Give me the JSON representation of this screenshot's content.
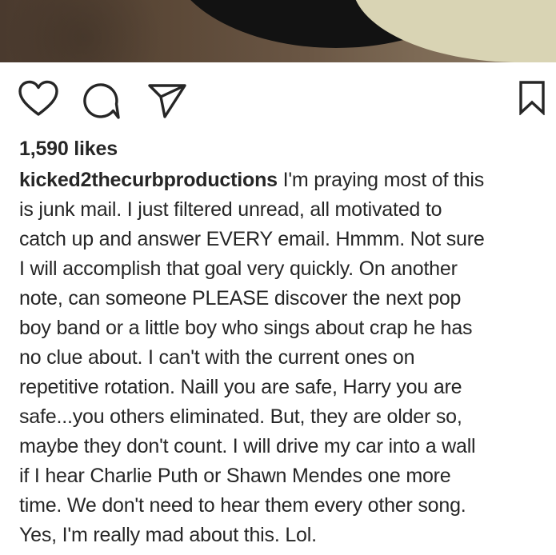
{
  "post": {
    "likes_text": "1,590 likes",
    "username": "kicked2thecurbproductions",
    "caption_lines": [
      " I'm praying most of this",
      "is junk mail. I just filtered unread, all motivated to",
      "catch up and answer EVERY email. Hmmm. Not sure",
      "I will accomplish that goal very quickly. On another",
      "note, can someone PLEASE discover the next pop",
      "boy band or a little boy who sings about crap he has",
      "no clue about. I can't with the current ones on",
      "repetitive rotation. Naill you are safe, Harry you are",
      "safe...you others eliminated. But, they are older so,",
      "maybe they don't count. I will drive my car into a wall",
      "if I hear Charlie Puth or Shawn Mendes one more",
      "time. We don't need to hear them every other song.",
      "Yes, I'm really mad about this. Lol."
    ]
  },
  "actions": {
    "icons": [
      "heart-icon",
      "comment-icon",
      "share-icon",
      "bookmark-icon"
    ]
  },
  "colors": {
    "text": "#262626",
    "icon_stroke": "#262626",
    "background": "#ffffff"
  }
}
